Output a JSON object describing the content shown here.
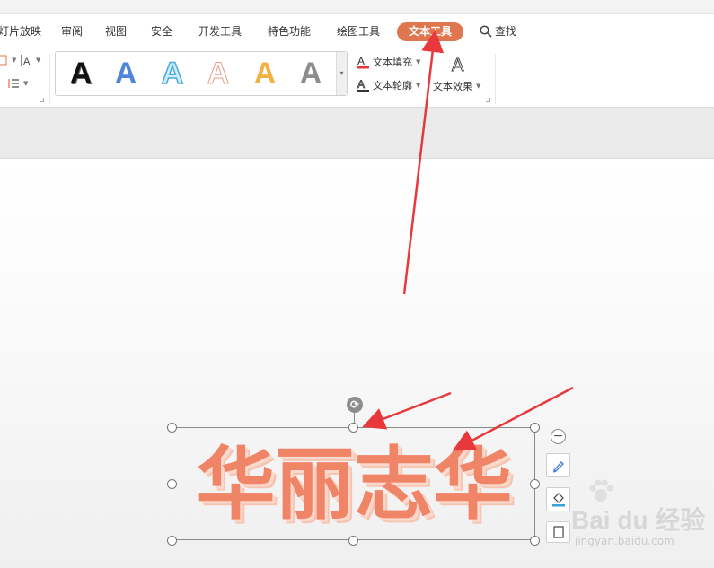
{
  "menu": {
    "items": [
      {
        "id": "slideshow",
        "label": "灯片放映"
      },
      {
        "id": "review",
        "label": "审阅"
      },
      {
        "id": "view",
        "label": "视图"
      },
      {
        "id": "security",
        "label": "安全"
      },
      {
        "id": "devtools",
        "label": "开发工具"
      },
      {
        "id": "features",
        "label": "特色功能"
      },
      {
        "id": "drawing",
        "label": "绘图工具"
      }
    ],
    "active_label": "文本工具",
    "search_label": "查找"
  },
  "ribbon": {
    "style_letter": "A",
    "fill_label": "文本填充",
    "outline_label": "文本轮廓",
    "effects_label": "文本效果"
  },
  "canvas": {
    "textbox_text": "华丽志华"
  },
  "watermark": {
    "brand": "Bai du 经验",
    "url": "jingyan.baidu.com"
  },
  "colors": {
    "accent": "#e0764f",
    "text_orange": "#ef8466",
    "arrow_red": "#e8383b"
  }
}
